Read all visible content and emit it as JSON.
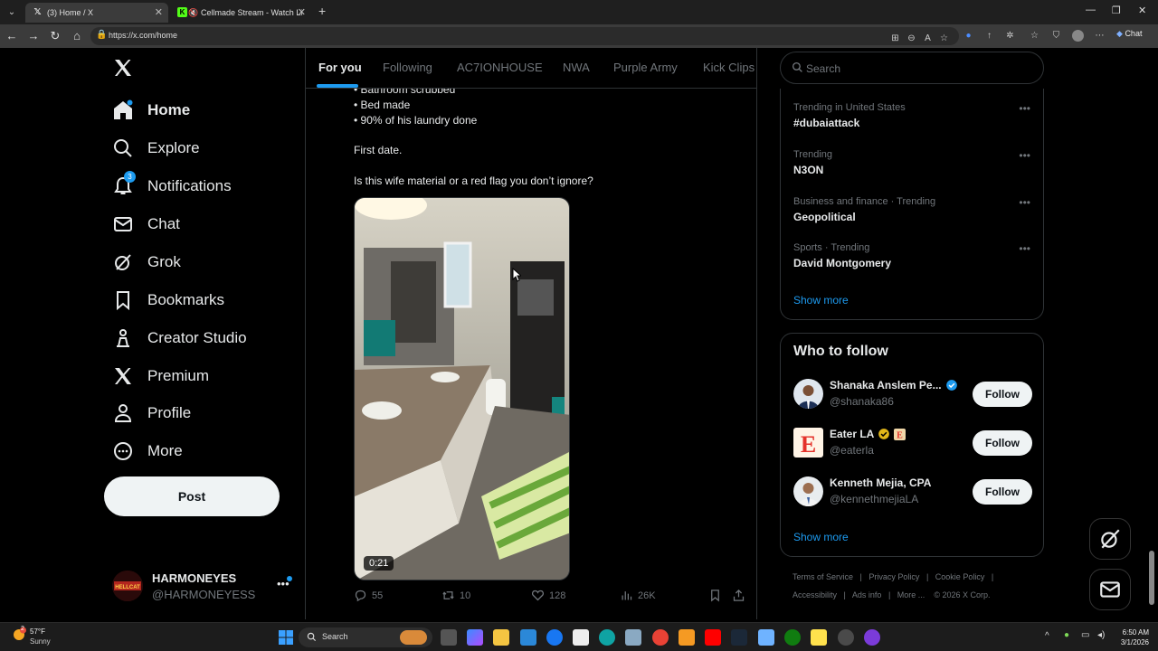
{
  "browser": {
    "tabs": [
      {
        "title": "(3) Home / X",
        "active": true
      },
      {
        "title": "Cellmade Stream - Watch Li",
        "active": false
      }
    ],
    "url": "https://x.com/home",
    "chat_label": "Chat"
  },
  "sidebar": {
    "items": [
      {
        "label": "Home",
        "icon": "home-icon"
      },
      {
        "label": "Explore",
        "icon": "search-icon"
      },
      {
        "label": "Notifications",
        "icon": "bell-icon",
        "badge": "3"
      },
      {
        "label": "Chat",
        "icon": "mail-icon"
      },
      {
        "label": "Grok",
        "icon": "grok-icon"
      },
      {
        "label": "Bookmarks",
        "icon": "bookmark-icon"
      },
      {
        "label": "Creator Studio",
        "icon": "creator-studio-icon"
      },
      {
        "label": "Premium",
        "icon": "x-logo-icon"
      },
      {
        "label": "Profile",
        "icon": "person-icon"
      },
      {
        "label": "More",
        "icon": "more-circle-icon"
      }
    ],
    "post_label": "Post",
    "account": {
      "name": "HARMONEYES",
      "handle": "@HARMONEYESS"
    }
  },
  "feed": {
    "tabs": [
      "For you",
      "Following",
      "AC7IONHOUSE",
      "NWA",
      "Purple Army",
      "Kick Clips"
    ],
    "post": {
      "lines": [
        "• Bathroom scrubbed",
        "• Bed made",
        "• 90% of his laundry done",
        "First date.",
        "Is this wife material or a red flag you don’t ignore?"
      ],
      "video_duration": "0:21",
      "replies": "55",
      "reposts": "10",
      "likes": "128",
      "views": "26K"
    }
  },
  "right": {
    "search_placeholder": "Search",
    "trends": [
      {
        "context": "Trending in United States",
        "title": "#dubaiattack"
      },
      {
        "context": "Trending",
        "title": "N3ON"
      },
      {
        "context": "Business and finance · Trending",
        "title": "Geopolitical"
      },
      {
        "context": "Sports · Trending",
        "title": "David Montgomery"
      }
    ],
    "show_more": "Show more",
    "who_to_follow": {
      "title": "Who to follow",
      "accounts": [
        {
          "name": "Shanaka Anslem Pe...",
          "handle": "@shanaka86"
        },
        {
          "name": "Eater LA",
          "handle": "@eaterla"
        },
        {
          "name": "Kenneth Mejia, CPA",
          "handle": "@kennethmejiaLA"
        }
      ],
      "follow_label": "Follow",
      "show_more": "Show more"
    },
    "footer": {
      "links": [
        "Terms of Service",
        "Privacy Policy",
        "Cookie Policy",
        "Accessibility",
        "Ads info",
        "More ...",
        "© 2026 X Corp."
      ],
      "sep": "|"
    }
  },
  "taskbar": {
    "weather_temp": "57°F",
    "weather_cond": "Sunny",
    "weather_badge": "2",
    "search_label": "Search",
    "time": "6:50 AM",
    "date": "3/1/2026"
  },
  "colors": {
    "accent": "#1d9bf0",
    "background": "#000000",
    "border": "#2f3336",
    "muted": "#71767b"
  }
}
